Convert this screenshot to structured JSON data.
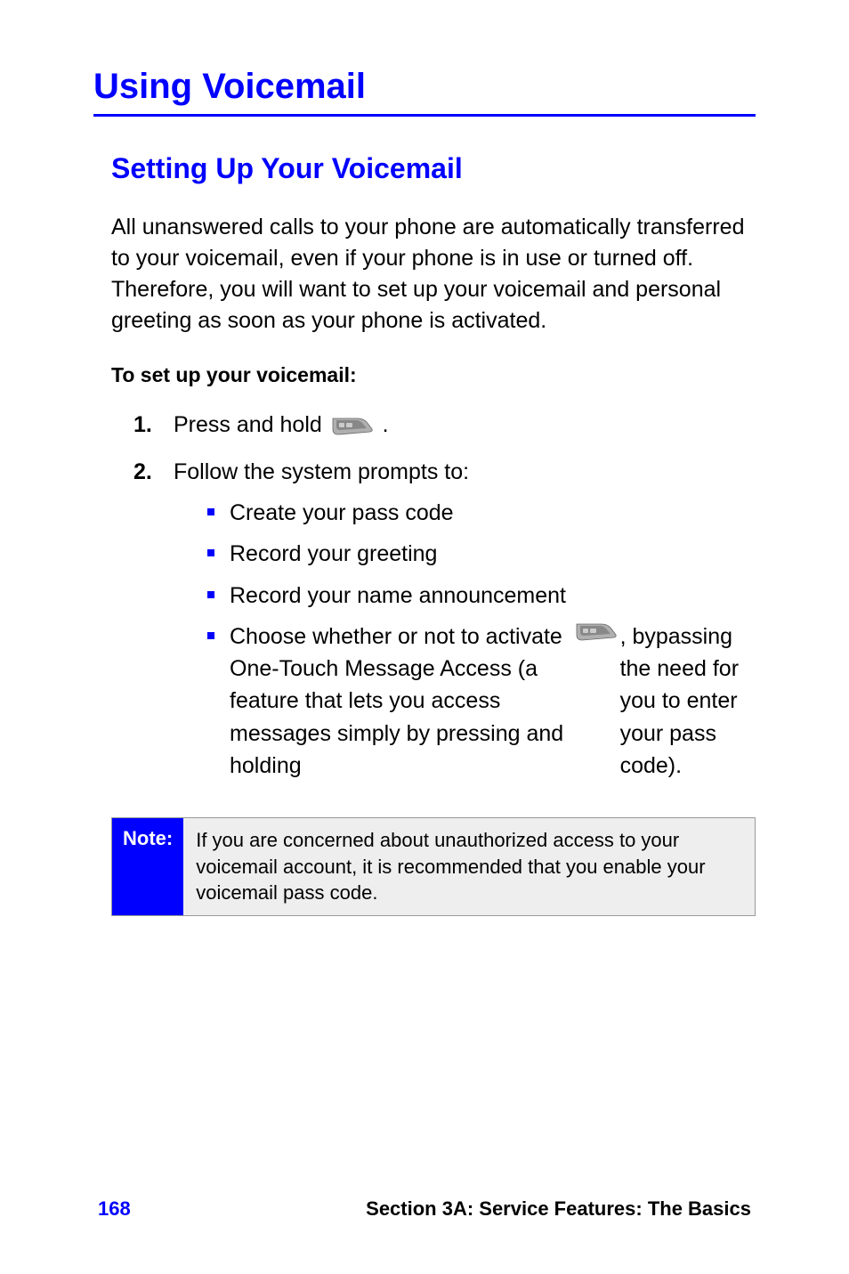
{
  "section_title": "Using Voicemail",
  "subsection_title": "Setting Up Your Voicemail",
  "intro_paragraph": "All unanswered calls to your phone are automatically transferred to your voicemail, even if your phone is in use or turned off. Therefore, you will want to set up your voicemail and personal greeting as soon as your phone is activated.",
  "sub_heading": "To set up your voicemail:",
  "steps": [
    {
      "num": "1.",
      "text_before_icon": "Press and hold  ",
      "text_after_icon": "."
    },
    {
      "num": "2.",
      "text": "Follow the system prompts to:"
    }
  ],
  "bullets": [
    "Create your pass code",
    "Record your greeting",
    "Record your name announcement"
  ],
  "last_bullet": {
    "text_before_icon": "Choose whether or not to activate One-Touch Message Access (a feature that lets you access messages simply by pressing and holding  ",
    "text_after_icon": ", bypassing the need for you to enter your pass code)."
  },
  "note": {
    "label": "Note:",
    "content": "If you are concerned about unauthorized access to your voicemail account, it is recommended that  you enable your voicemail pass code."
  },
  "footer": {
    "page_num": "168",
    "title": "Section 3A: Service Features: The Basics"
  }
}
